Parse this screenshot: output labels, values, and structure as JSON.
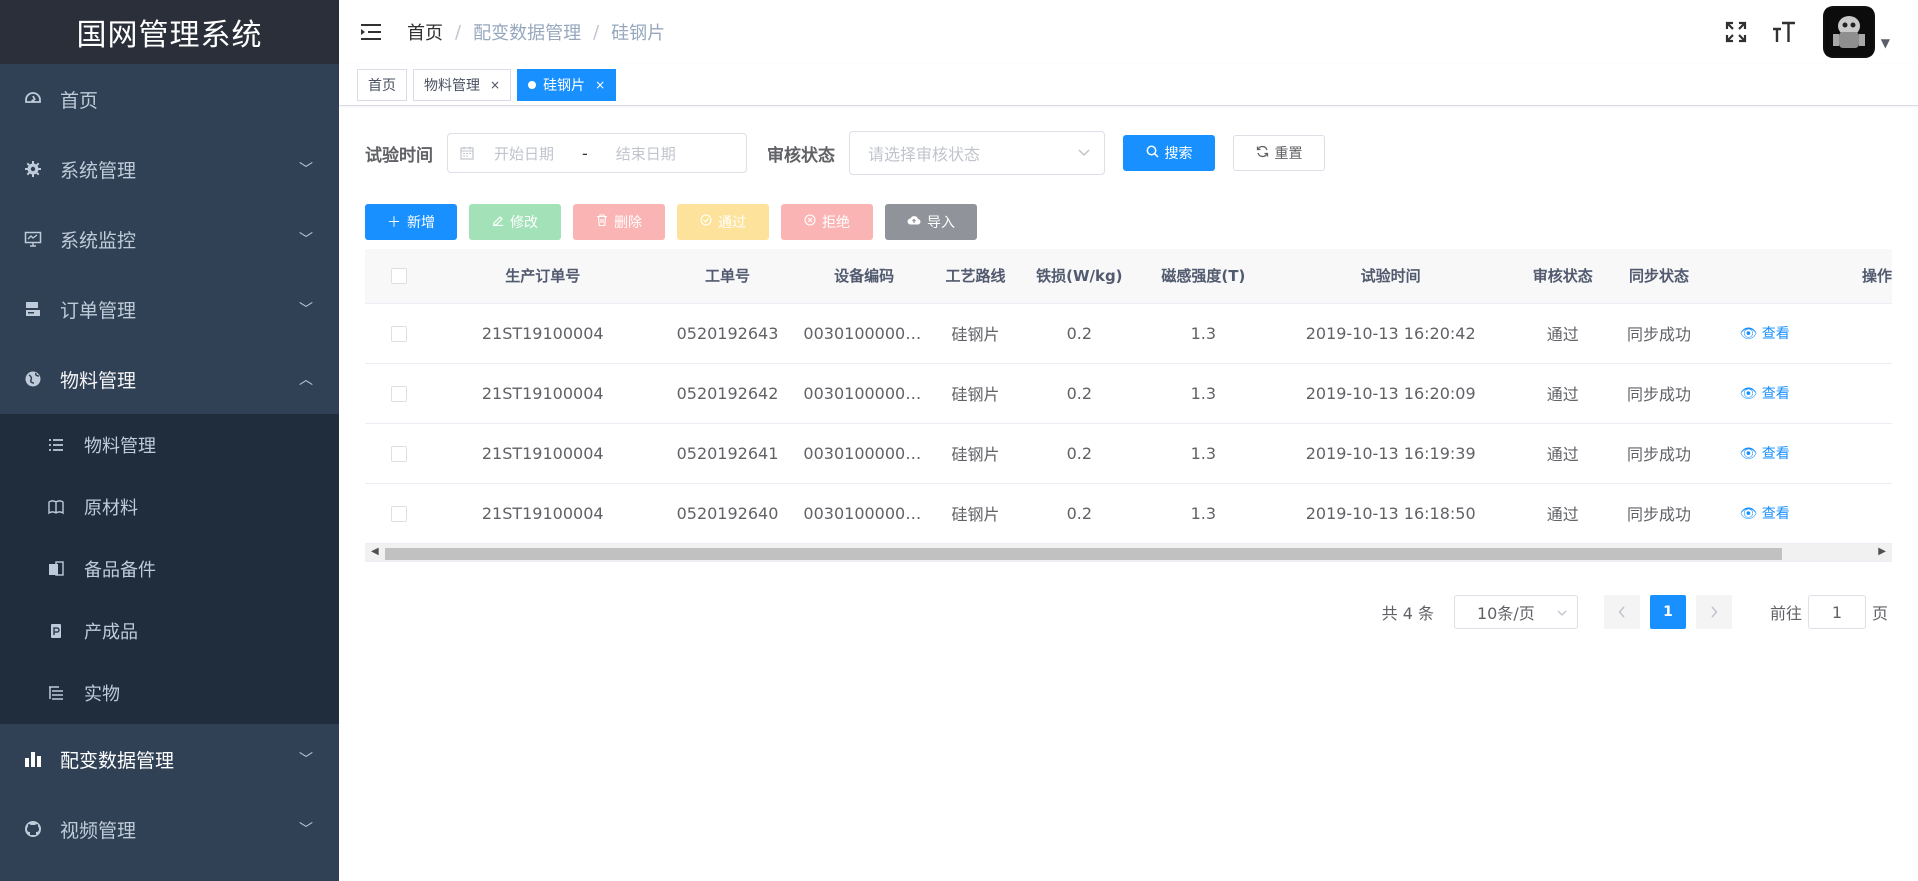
{
  "app": {
    "title": "国网管理系统"
  },
  "sidebar": {
    "items": [
      {
        "label": "首页",
        "icon": "dashboard-icon"
      },
      {
        "label": "系统管理",
        "icon": "gear-icon"
      },
      {
        "label": "系统监控",
        "icon": "monitor-icon"
      },
      {
        "label": "订单管理",
        "icon": "server-icon"
      },
      {
        "label": "物料管理",
        "icon": "globe-icon",
        "expanded": true
      }
    ],
    "subitems": [
      {
        "label": "物料管理",
        "icon": "list-icon"
      },
      {
        "label": "原材料",
        "icon": "book-icon"
      },
      {
        "label": "备品备件",
        "icon": "clipboard-icon"
      },
      {
        "label": "产成品",
        "icon": "product-icon"
      },
      {
        "label": "实物",
        "icon": "tree-list-icon"
      }
    ],
    "bottom_items": [
      {
        "label": "配变数据管理",
        "icon": "bar-chart-icon"
      },
      {
        "label": "视频管理",
        "icon": "github-icon"
      }
    ]
  },
  "header": {
    "breadcrumb": [
      "首页",
      "配变数据管理",
      "硅钢片"
    ]
  },
  "tags": [
    {
      "label": "首页",
      "closable": false
    },
    {
      "label": "物料管理",
      "closable": true
    },
    {
      "label": "硅钢片",
      "closable": true,
      "active": true
    }
  ],
  "search": {
    "time_label": "试验时间",
    "start_placeholder": "开始日期",
    "range_separator": "-",
    "end_placeholder": "结束日期",
    "status_label": "审核状态",
    "status_placeholder": "请选择审核状态",
    "search_button": "搜索",
    "reset_button": "重置"
  },
  "toolbar": {
    "add": "新增",
    "edit": "修改",
    "delete": "删除",
    "pass": "通过",
    "reject": "拒绝",
    "import": "导入"
  },
  "table": {
    "columns": [
      "生产订单号",
      "工单号",
      "设备编码",
      "工艺路线",
      "铁损(W/kg)",
      "磁感强度(T)",
      "试验时间",
      "审核状态",
      "同步状态",
      "操作"
    ],
    "rows": [
      {
        "order": "21ST19100004",
        "work": "0520192643",
        "device": "00301000000...",
        "route": "硅钢片",
        "loss": "0.2",
        "induction": "1.3",
        "time": "2019-10-13 16:20:42",
        "audit": "通过",
        "sync": "同步成功",
        "action": "查看"
      },
      {
        "order": "21ST19100004",
        "work": "0520192642",
        "device": "00301000000...",
        "route": "硅钢片",
        "loss": "0.2",
        "induction": "1.3",
        "time": "2019-10-13 16:20:09",
        "audit": "通过",
        "sync": "同步成功",
        "action": "查看"
      },
      {
        "order": "21ST19100004",
        "work": "0520192641",
        "device": "00301000000...",
        "route": "硅钢片",
        "loss": "0.2",
        "induction": "1.3",
        "time": "2019-10-13 16:19:39",
        "audit": "通过",
        "sync": "同步成功",
        "action": "查看"
      },
      {
        "order": "21ST19100004",
        "work": "0520192640",
        "device": "00301000000...",
        "route": "硅钢片",
        "loss": "0.2",
        "induction": "1.3",
        "time": "2019-10-13 16:18:50",
        "audit": "通过",
        "sync": "同步成功",
        "action": "查看"
      }
    ]
  },
  "pagination": {
    "total_text": "共 4 条",
    "page_size": "10条/页",
    "current_page": "1",
    "goto_label": "前往",
    "goto_value": "1",
    "page_suffix": "页"
  },
  "colors": {
    "sidebar_bg": "#304156",
    "primary": "#1890ff"
  }
}
